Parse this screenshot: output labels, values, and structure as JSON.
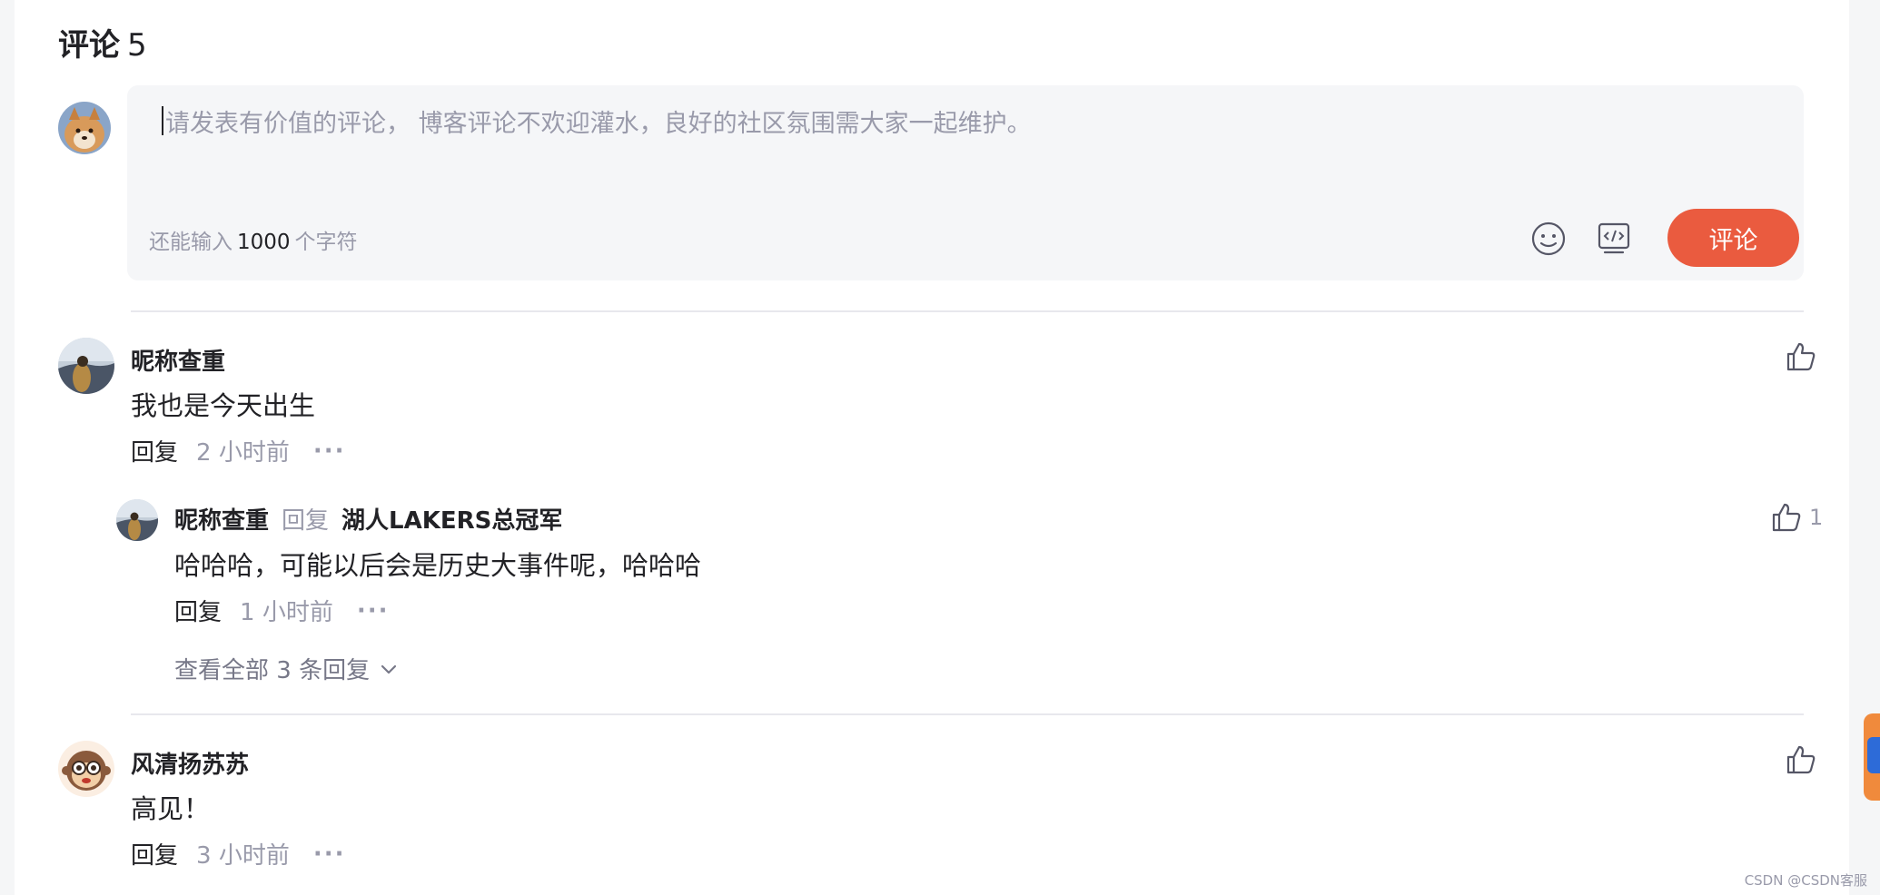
{
  "header": {
    "title": "评论",
    "count": "5"
  },
  "editor": {
    "placeholder": "请发表有价值的评论， 博客评论不欢迎灌水，良好的社区氛围需大家一起维护。",
    "counter_prefix": "还能输入",
    "counter_value": "1000",
    "counter_suffix": "个字符",
    "submit_label": "评论",
    "emoji_icon": "emoji-icon",
    "code_icon": "code-icon"
  },
  "comments": [
    {
      "author": "昵称查重",
      "content": "我也是今天出生",
      "reply_label": "回复",
      "time": "2 小时前",
      "more": "···",
      "replies": [
        {
          "author": "昵称查重",
          "reply_word": "回复",
          "target": "湖人LAKERS总冠军",
          "content": "哈哈哈，可能以后会是历史大事件呢，哈哈哈",
          "reply_label": "回复",
          "time": "1 小时前",
          "more": "···",
          "likes": "1"
        }
      ],
      "view_all": "查看全部 3 条回复"
    },
    {
      "author": "风清扬苏苏",
      "content": "高见！",
      "reply_label": "回复",
      "time": "3 小时前",
      "more": "···"
    }
  ],
  "watermark": "CSDN @CSDN客服",
  "colors": {
    "accent": "#ea5b3f",
    "text": "#222226",
    "muted": "#999aaa",
    "editor_bg": "#f5f6f8"
  }
}
